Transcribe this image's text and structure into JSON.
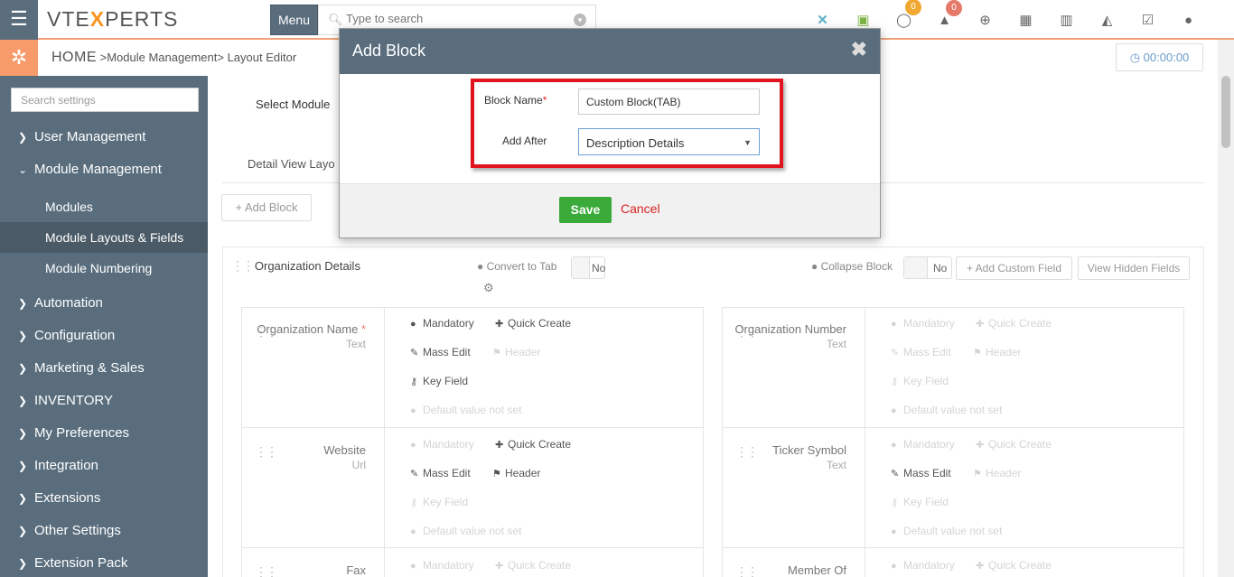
{
  "header": {
    "logo_text_a": "VTE",
    "logo_text_b": "X",
    "logo_text_c": "PERTS",
    "menu_label": "Menu",
    "search_placeholder": "Type to search",
    "chat_badge": "0",
    "bell_badge": "0",
    "timer": "00:00:00"
  },
  "breadcrumb": {
    "home": "HOME",
    "sep1": ">",
    "module_mgmt": "Module Management",
    "sep2": ">",
    "layout_editor": "Layout Editor"
  },
  "sidebar": {
    "search_placeholder": "Search settings",
    "items": [
      {
        "label": "User Management",
        "chev": "❯"
      },
      {
        "label": "Module Management",
        "chev": "⌄"
      },
      {
        "label": "Automation",
        "chev": "❯"
      },
      {
        "label": "Configuration",
        "chev": "❯"
      },
      {
        "label": "Marketing & Sales",
        "chev": "❯"
      },
      {
        "label": "INVENTORY",
        "chev": "❯"
      },
      {
        "label": "My Preferences",
        "chev": "❯"
      },
      {
        "label": "Integration",
        "chev": "❯"
      },
      {
        "label": "Extensions",
        "chev": "❯"
      },
      {
        "label": "Other Settings",
        "chev": "❯"
      },
      {
        "label": "Extension Pack",
        "chev": "❯"
      }
    ],
    "subitems": [
      "Modules",
      "Module Layouts & Fields",
      "Module Numbering"
    ]
  },
  "main": {
    "select_module": "Select Module",
    "tab_detail": "Detail View Layo",
    "add_block": "+ Add Block",
    "block_title": "Organization Details",
    "convert_to_tab": "Convert to Tab",
    "convert_toggle": "No",
    "collapse_block": "Collapse Block",
    "collapse_toggle": "No",
    "add_custom_field": "+ Add Custom Field",
    "view_hidden_fields": "View Hidden Fields"
  },
  "fields": [
    {
      "name": "Organization Name",
      "required": "*",
      "type": "Text"
    },
    {
      "name": "Organization Number",
      "type": "Text"
    },
    {
      "name": "Website",
      "type": "Url"
    },
    {
      "name": "Ticker Symbol",
      "type": "Text"
    },
    {
      "name": "Fax",
      "type": ""
    },
    {
      "name": "Member Of",
      "type": ""
    }
  ],
  "field_options": {
    "mandatory": "Mandatory",
    "quick_create": "Quick Create",
    "mass_edit": "Mass Edit",
    "header": "Header",
    "key_field": "Key Field",
    "default_value": "Default value not set"
  },
  "modal": {
    "title": "Add Block",
    "close": "✖",
    "block_name_label": "Block Name",
    "required_mark": "*",
    "block_name_value": "Custom Block(TAB)",
    "add_after_label": "Add After",
    "add_after_value": "Description Details",
    "save": "Save",
    "cancel": "Cancel"
  },
  "colors": {
    "header_slate": "#596d7d",
    "accent_orange": "#f79b6a",
    "save_green": "#3aaa3a",
    "highlight_red": "#e1141e"
  }
}
